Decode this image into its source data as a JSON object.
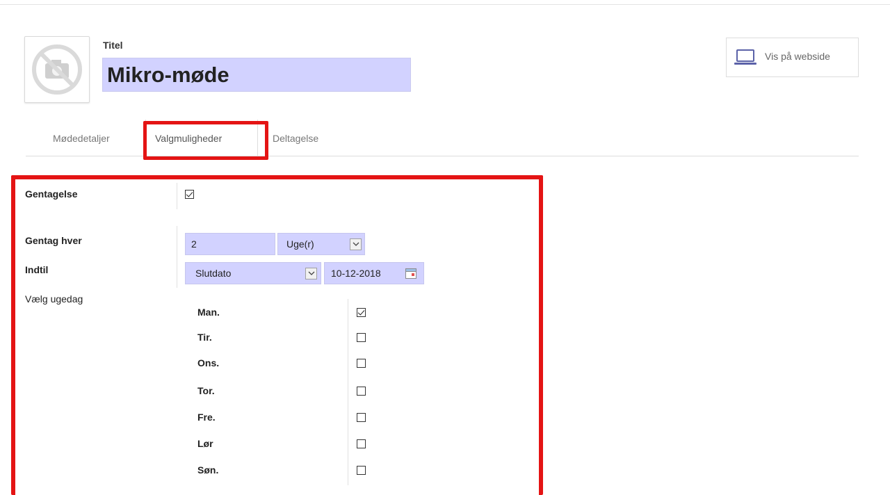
{
  "header": {
    "title_label": "Titel",
    "title_value": "Mikro-møde",
    "website_button": "Vis på webside",
    "avatar_icon": "camera-off-icon",
    "website_icon": "laptop-icon"
  },
  "tabs": [
    {
      "label": "Mødedetaljer",
      "active": false
    },
    {
      "label": "Valgmuligheder",
      "active": true
    },
    {
      "label": "Deltagelse",
      "active": false
    }
  ],
  "form": {
    "recurrence_label": "Gentagelse",
    "recurrence_checked": true,
    "repeat_every_label": "Gentag hver",
    "repeat_every_value": "2",
    "repeat_unit": "Uge(r)",
    "until_label": "Indtil",
    "until_option": "Slutdato",
    "until_date": "10-12-2018",
    "weekday_label": "Vælg ugedag",
    "weekdays": [
      {
        "label": "Man.",
        "checked": true
      },
      {
        "label": "Tir.",
        "checked": false
      },
      {
        "label": "Ons.",
        "checked": false
      },
      {
        "label": "Tor.",
        "checked": false
      },
      {
        "label": "Fre.",
        "checked": false
      },
      {
        "label": "Lør",
        "checked": false
      },
      {
        "label": "Søn.",
        "checked": false
      }
    ]
  },
  "colors": {
    "highlight": "#e41414",
    "field_bg": "#d2d2ff"
  }
}
